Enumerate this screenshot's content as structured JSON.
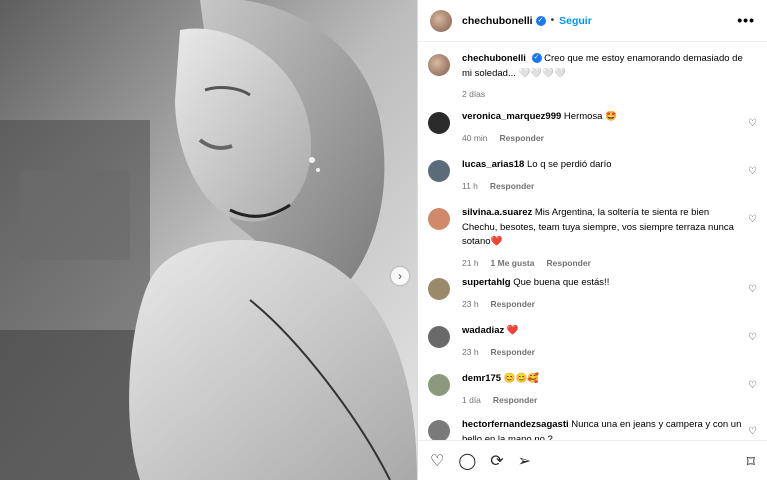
{
  "post": {
    "author": "chechubonelli",
    "follow_label": "Seguir",
    "more_label": "•••",
    "caption": "Creo que me estoy enamorando demasiado de mi soledad... 🤍🤍🤍🤍",
    "caption_time": "2 días"
  },
  "comments": [
    {
      "user": "veronica_marquez999",
      "text": "Hermosa 🤩",
      "time": "40 min",
      "likes": "",
      "reply": "Responder",
      "color": "#2b2b2b"
    },
    {
      "user": "lucas_arias18",
      "text": "Lo q se perdió darío",
      "time": "11 h",
      "likes": "",
      "reply": "Responder",
      "color": "#5c6b7a"
    },
    {
      "user": "silvina.a.suarez",
      "text": "Mis Argentina, la soltería te sienta re bien Chechu, besotes, team tuya siempre, vos siempre terraza nunca sotano❤️",
      "time": "21 h",
      "likes": "1 Me gusta",
      "reply": "Responder",
      "color": "#d08a6a"
    },
    {
      "user": "supertahlg",
      "text": "Que buena que estás!!",
      "time": "23 h",
      "likes": "",
      "reply": "Responder",
      "color": "#9a8a6a"
    },
    {
      "user": "wadadiaz",
      "text": "❤️",
      "time": "23 h",
      "likes": "",
      "reply": "Responder",
      "color": "#6a6a6a"
    },
    {
      "user": "demr175",
      "text": "😊😊🥰",
      "time": "1 día",
      "likes": "",
      "reply": "Responder",
      "color": "#8a9a7a"
    },
    {
      "user": "hectorfernandezsagasti",
      "text": "Nunca una en jeans y campera y con un bello en la mano no ?",
      "time": "",
      "likes": "",
      "reply": "",
      "color": "#7a7a7a"
    }
  ],
  "icons": {
    "like": "heart-icon",
    "comment": "comment-icon",
    "share": "repost-icon",
    "send": "send-icon",
    "save": "bookmark-icon",
    "verified": "verified-icon"
  },
  "colors": {
    "accent": "#0095f6",
    "verified": "#1877f2",
    "muted": "#737373"
  }
}
